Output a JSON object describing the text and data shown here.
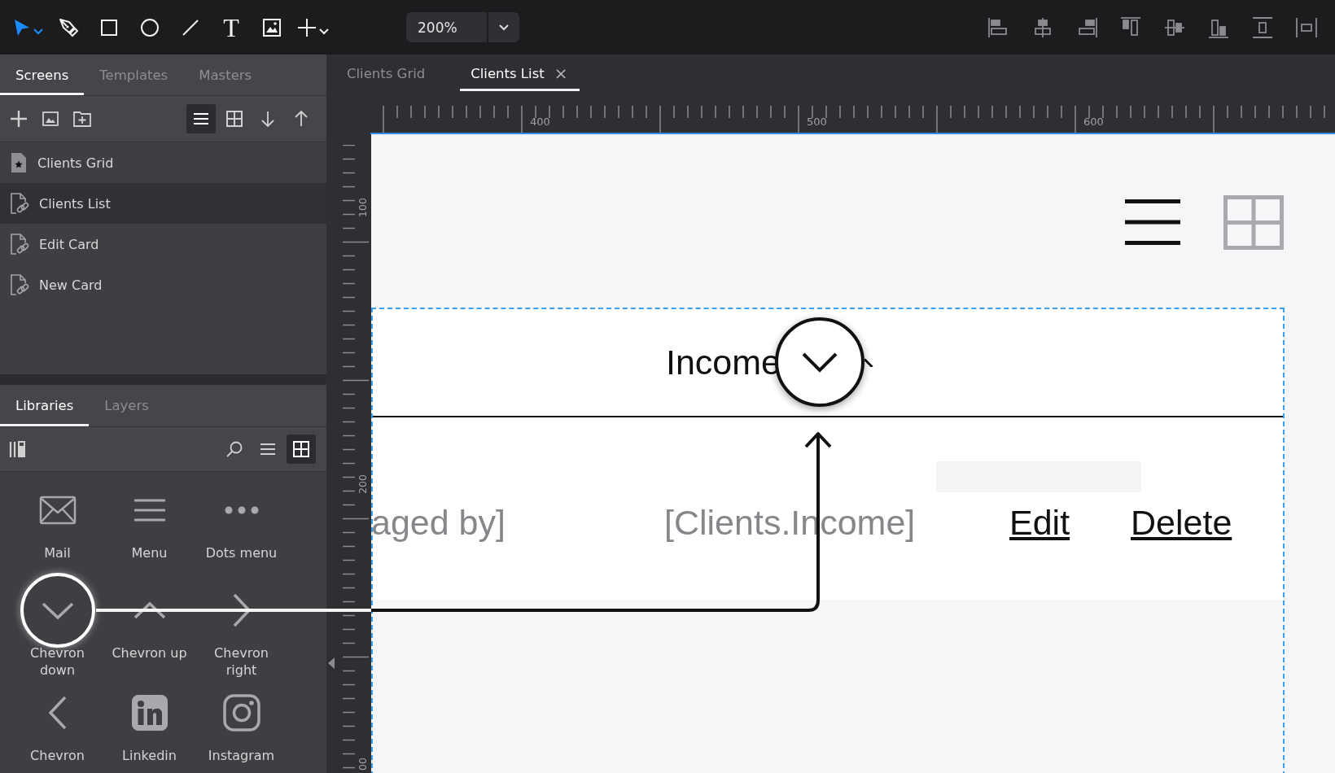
{
  "toolbar": {
    "tools": [
      {
        "kind": "select",
        "selected": true,
        "menu": true
      },
      {
        "kind": "pen",
        "selected": false,
        "menu": false
      },
      {
        "kind": "rectangle",
        "selected": false,
        "menu": false
      },
      {
        "kind": "ellipse",
        "selected": false,
        "menu": false
      },
      {
        "kind": "line",
        "selected": false,
        "menu": false
      },
      {
        "kind": "text",
        "selected": false,
        "menu": false,
        "glyph": "T"
      },
      {
        "kind": "image",
        "selected": false,
        "menu": false
      },
      {
        "kind": "add",
        "selected": false,
        "menu": true
      }
    ],
    "zoom": {
      "value": "200%"
    }
  },
  "screens_panel": {
    "tabs": [
      {
        "label": "Screens",
        "selected": true
      },
      {
        "label": "Templates",
        "selected": false
      },
      {
        "label": "Masters",
        "selected": false
      }
    ],
    "view_modes": [
      {
        "kind": "list",
        "selected": true
      },
      {
        "kind": "grid",
        "selected": false
      }
    ],
    "screens": [
      {
        "label": "Clients Grid",
        "kind": "home",
        "selected": false
      },
      {
        "label": "Clients List",
        "kind": "page",
        "selected": true
      },
      {
        "label": "Edit Card",
        "kind": "page",
        "selected": false
      },
      {
        "label": "New Card",
        "kind": "page",
        "selected": false
      }
    ]
  },
  "libraries_panel": {
    "tabs": [
      {
        "label": "Libraries",
        "selected": true
      },
      {
        "label": "Layers",
        "selected": false
      }
    ],
    "view_modes": [
      {
        "kind": "list",
        "selected": false
      },
      {
        "kind": "grid",
        "selected": true
      }
    ],
    "items": [
      {
        "label": "Mail",
        "kind": "mail",
        "selected": false
      },
      {
        "label": "Menu",
        "kind": "menu",
        "selected": false
      },
      {
        "label": "Dots menu",
        "kind": "dots",
        "selected": false
      },
      {
        "label": "Chevron down",
        "kind": "chevron-down",
        "selected": true
      },
      {
        "label": "Chevron up",
        "kind": "chevron-up",
        "selected": false
      },
      {
        "label": "Chevron right",
        "kind": "chevron-right",
        "selected": false
      },
      {
        "label": "Chevron",
        "kind": "chevron-left",
        "selected": false
      },
      {
        "label": "Linkedin",
        "kind": "linkedin",
        "selected": false
      },
      {
        "label": "Instagram",
        "kind": "instagram",
        "selected": false
      }
    ]
  },
  "document_tabs": [
    {
      "label": "Clients Grid",
      "selected": false
    },
    {
      "label": "Clients List",
      "selected": true,
      "close": "×"
    }
  ],
  "rulers": {
    "horizontal": [
      "400",
      "500",
      "600"
    ],
    "vertical": [
      "100",
      "200",
      "00"
    ]
  },
  "canvas": {
    "header": "Income",
    "row": {
      "cells": [
        "aged by]",
        "[Clients.Income]"
      ],
      "links": [
        "Edit",
        "Delete"
      ]
    }
  }
}
